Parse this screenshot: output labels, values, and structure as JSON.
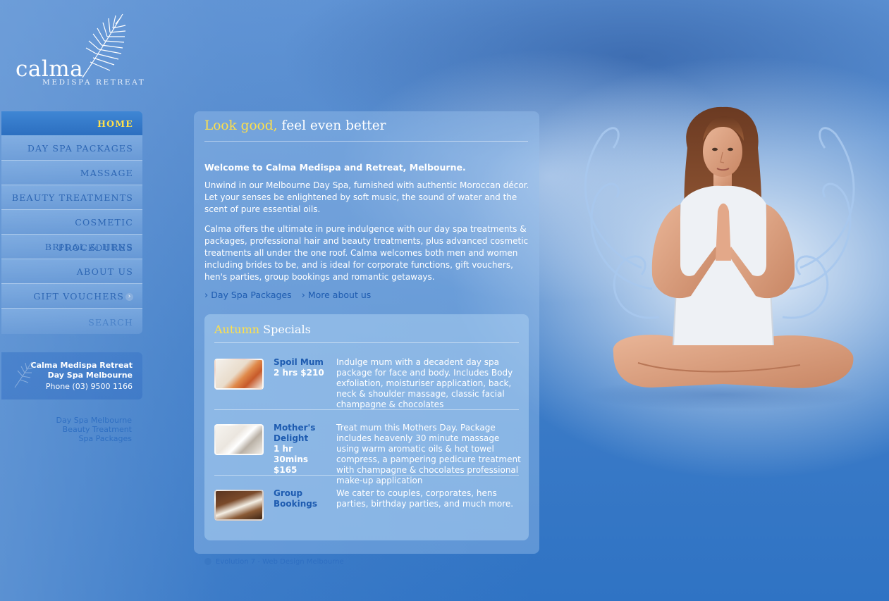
{
  "brand": {
    "name": "calma",
    "tagline": "MEDISPA RETREAT"
  },
  "nav": {
    "items": [
      {
        "label": "HOME"
      },
      {
        "label": "DAY SPA PACKAGES"
      },
      {
        "label": "MASSAGE"
      },
      {
        "label": "BEAUTY TREATMENTS"
      },
      {
        "label": "COSMETIC PROCEDURES"
      },
      {
        "label": "BRIDAL & HENS"
      },
      {
        "label": "ABOUT US"
      },
      {
        "label": "GIFT VOUCHERS"
      },
      {
        "label": "SEARCH"
      }
    ],
    "active": "HOME"
  },
  "contact": {
    "line1": "Calma Medispa Retreat",
    "line2": "Day Spa Melbourne",
    "phone": "Phone (03) 9500 1166"
  },
  "seo_links": [
    "Day Spa Melbourne",
    "Beauty Treatment",
    "Spa Packages"
  ],
  "main": {
    "headline_highlight": "Look good,",
    "headline_rest": " feel even better",
    "welcome": "Welcome to Calma Medispa and Retreat, Melbourne.",
    "para1": "Unwind in our Melbourne Day Spa, furnished with authentic Moroccan décor. Let your senses be enlightened by soft music, the sound of water and the scent of pure essential oils.",
    "para2": "Calma offers the ultimate in pure indulgence with our day spa treatments & packages, professional hair and beauty treatments, plus advanced cosmetic treatments all under the one roof. Calma welcomes both men and women including brides to be, and is ideal for corporate functions, gift vouchers, hen's parties, group bookings and romantic getaways.",
    "link1": "Day Spa Packages",
    "link2": "More about us"
  },
  "specials": {
    "title_highlight": "Autumn",
    "title_rest": " Specials",
    "items": [
      {
        "name": "Spoil Mum",
        "price": "2 hrs $210",
        "desc": "Indulge mum with a decadent day spa package for face and body. Includes Body exfoliation, moisturiser application, back, neck & shoulder massage, classic facial champagne & chocolates"
      },
      {
        "name": "Mother's Delight",
        "price": "1 hr 30mins $165",
        "desc": "Treat mum this Mothers Day. Package includes heavenly 30 minute massage using warm aromatic oils & hot towel compress, a pampering pedicure treatment with champagne & chocolates professional make-up application"
      },
      {
        "name": "Group Bookings",
        "price": "",
        "desc": "We cater to couples, corporates, hens parties, birthday parties, and much more."
      }
    ]
  },
  "footer": {
    "credit": "Evolution 7 - Web Design Melbourne"
  },
  "colors": {
    "accent_yellow": "#ffe04a",
    "link_blue": "#1d5bb0",
    "nav_active": "#2c6fc0"
  }
}
